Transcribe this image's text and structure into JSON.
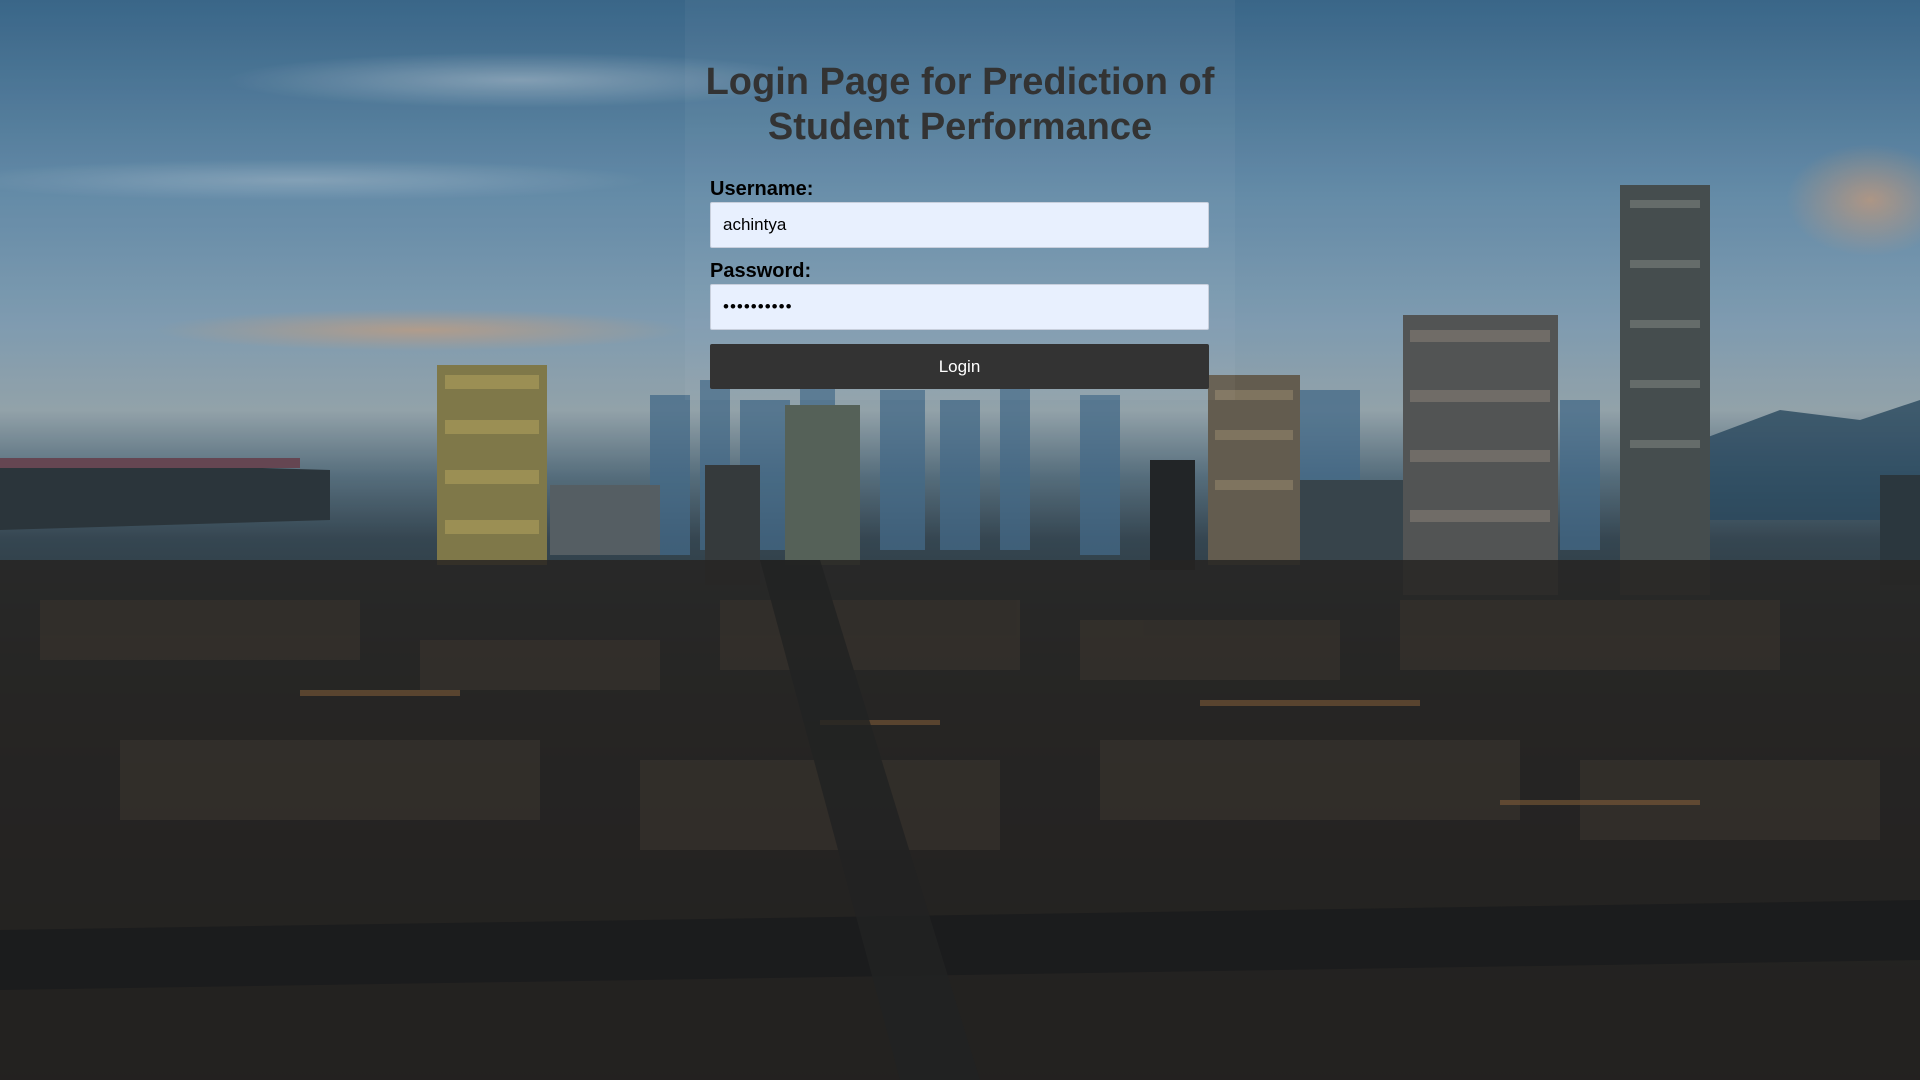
{
  "page": {
    "title": "Login Page for Prediction of Student Performance"
  },
  "form": {
    "username_label": "Username:",
    "username_value": "achintya",
    "password_label": "Password:",
    "password_value": "••••••••••",
    "login_label": "Login"
  },
  "colors": {
    "title": "#333333",
    "input_background": "#e8f0fe",
    "button_background": "#333333",
    "button_text": "#ffffff"
  },
  "background": {
    "description_icon": "city-skyline-background"
  }
}
